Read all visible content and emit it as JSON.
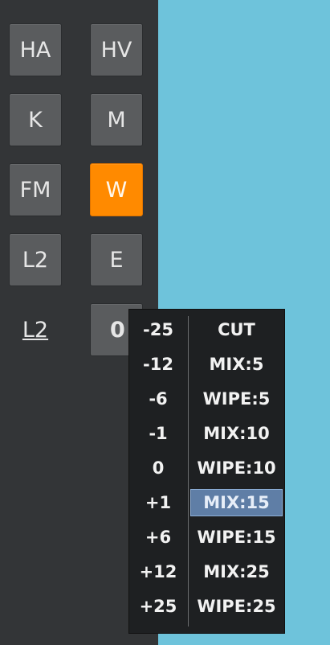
{
  "buttons": {
    "ha": "HA",
    "hv": "HV",
    "k": "K",
    "m": "M",
    "fm": "FM",
    "w": "W",
    "l2": "L2",
    "e": "E",
    "l2_link": "L2",
    "value": "0"
  },
  "colors": {
    "panel": "#333537",
    "canvas": "#6ec3db",
    "active": "#ff8a00",
    "selected": "#5f7ea6"
  },
  "dropdown": {
    "offsets": [
      "-25",
      "-12",
      "-6",
      "-1",
      "0",
      "+1",
      "+6",
      "+12",
      "+25"
    ],
    "transitions": [
      "CUT",
      "MIX:5",
      "WIPE:5",
      "MIX:10",
      "WIPE:10",
      "MIX:15",
      "WIPE:15",
      "MIX:25",
      "WIPE:25"
    ],
    "selected_transition": "MIX:15"
  }
}
